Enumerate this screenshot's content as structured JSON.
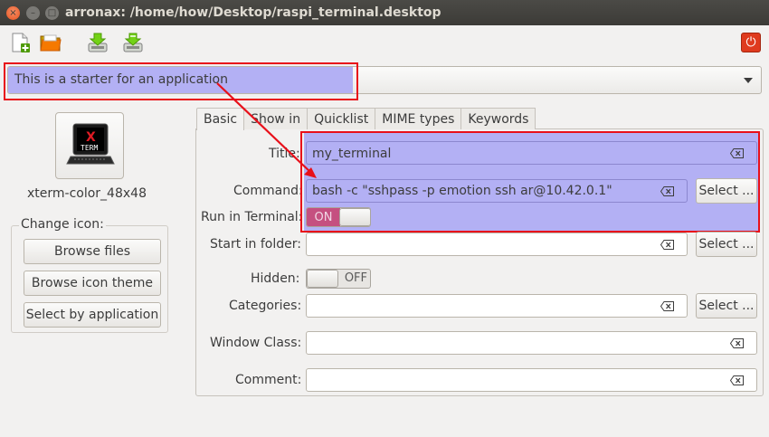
{
  "window": {
    "title": "arronax: /home/how/Desktop/raspi_terminal.desktop"
  },
  "window_controls": {
    "close": "×",
    "minimize": "–",
    "maximize": "□"
  },
  "toolbar": {
    "power_symbol": "⏻"
  },
  "comment_combo": {
    "value": "This is a starter for an application"
  },
  "icon_panel": {
    "icon_text_top": "X",
    "icon_text_bottom": "TERM",
    "icon_name": "xterm-color_48x48",
    "change_icon_label": "Change icon:",
    "browse_files": "Browse files",
    "browse_icon_theme": "Browse icon theme",
    "select_by_application": "Select by application"
  },
  "tabs": [
    "Basic",
    "Show in",
    "Quicklist",
    "MIME types",
    "Keywords"
  ],
  "form": {
    "title_label": "Title:",
    "title_value": "my_terminal",
    "command_label": "Command:",
    "command_value": "bash -c \"sshpass -p emotion ssh ar@10.42.0.1\"",
    "command_select": "Select ...",
    "run_in_terminal_label": "Run in Terminal:",
    "run_in_terminal_state": "ON",
    "start_in_folder_label": "Start in folder:",
    "start_in_folder_value": "",
    "start_in_folder_select": "Select ...",
    "hidden_label": "Hidden:",
    "hidden_state": "OFF",
    "categories_label": "Categories:",
    "categories_value": "",
    "categories_select": "Select ...",
    "window_class_label": "Window Class:",
    "window_class_value": "",
    "comment_label": "Comment:",
    "comment_value": ""
  },
  "annotation": {
    "color": "#e8101a",
    "highlight": "#b3b0f4"
  }
}
